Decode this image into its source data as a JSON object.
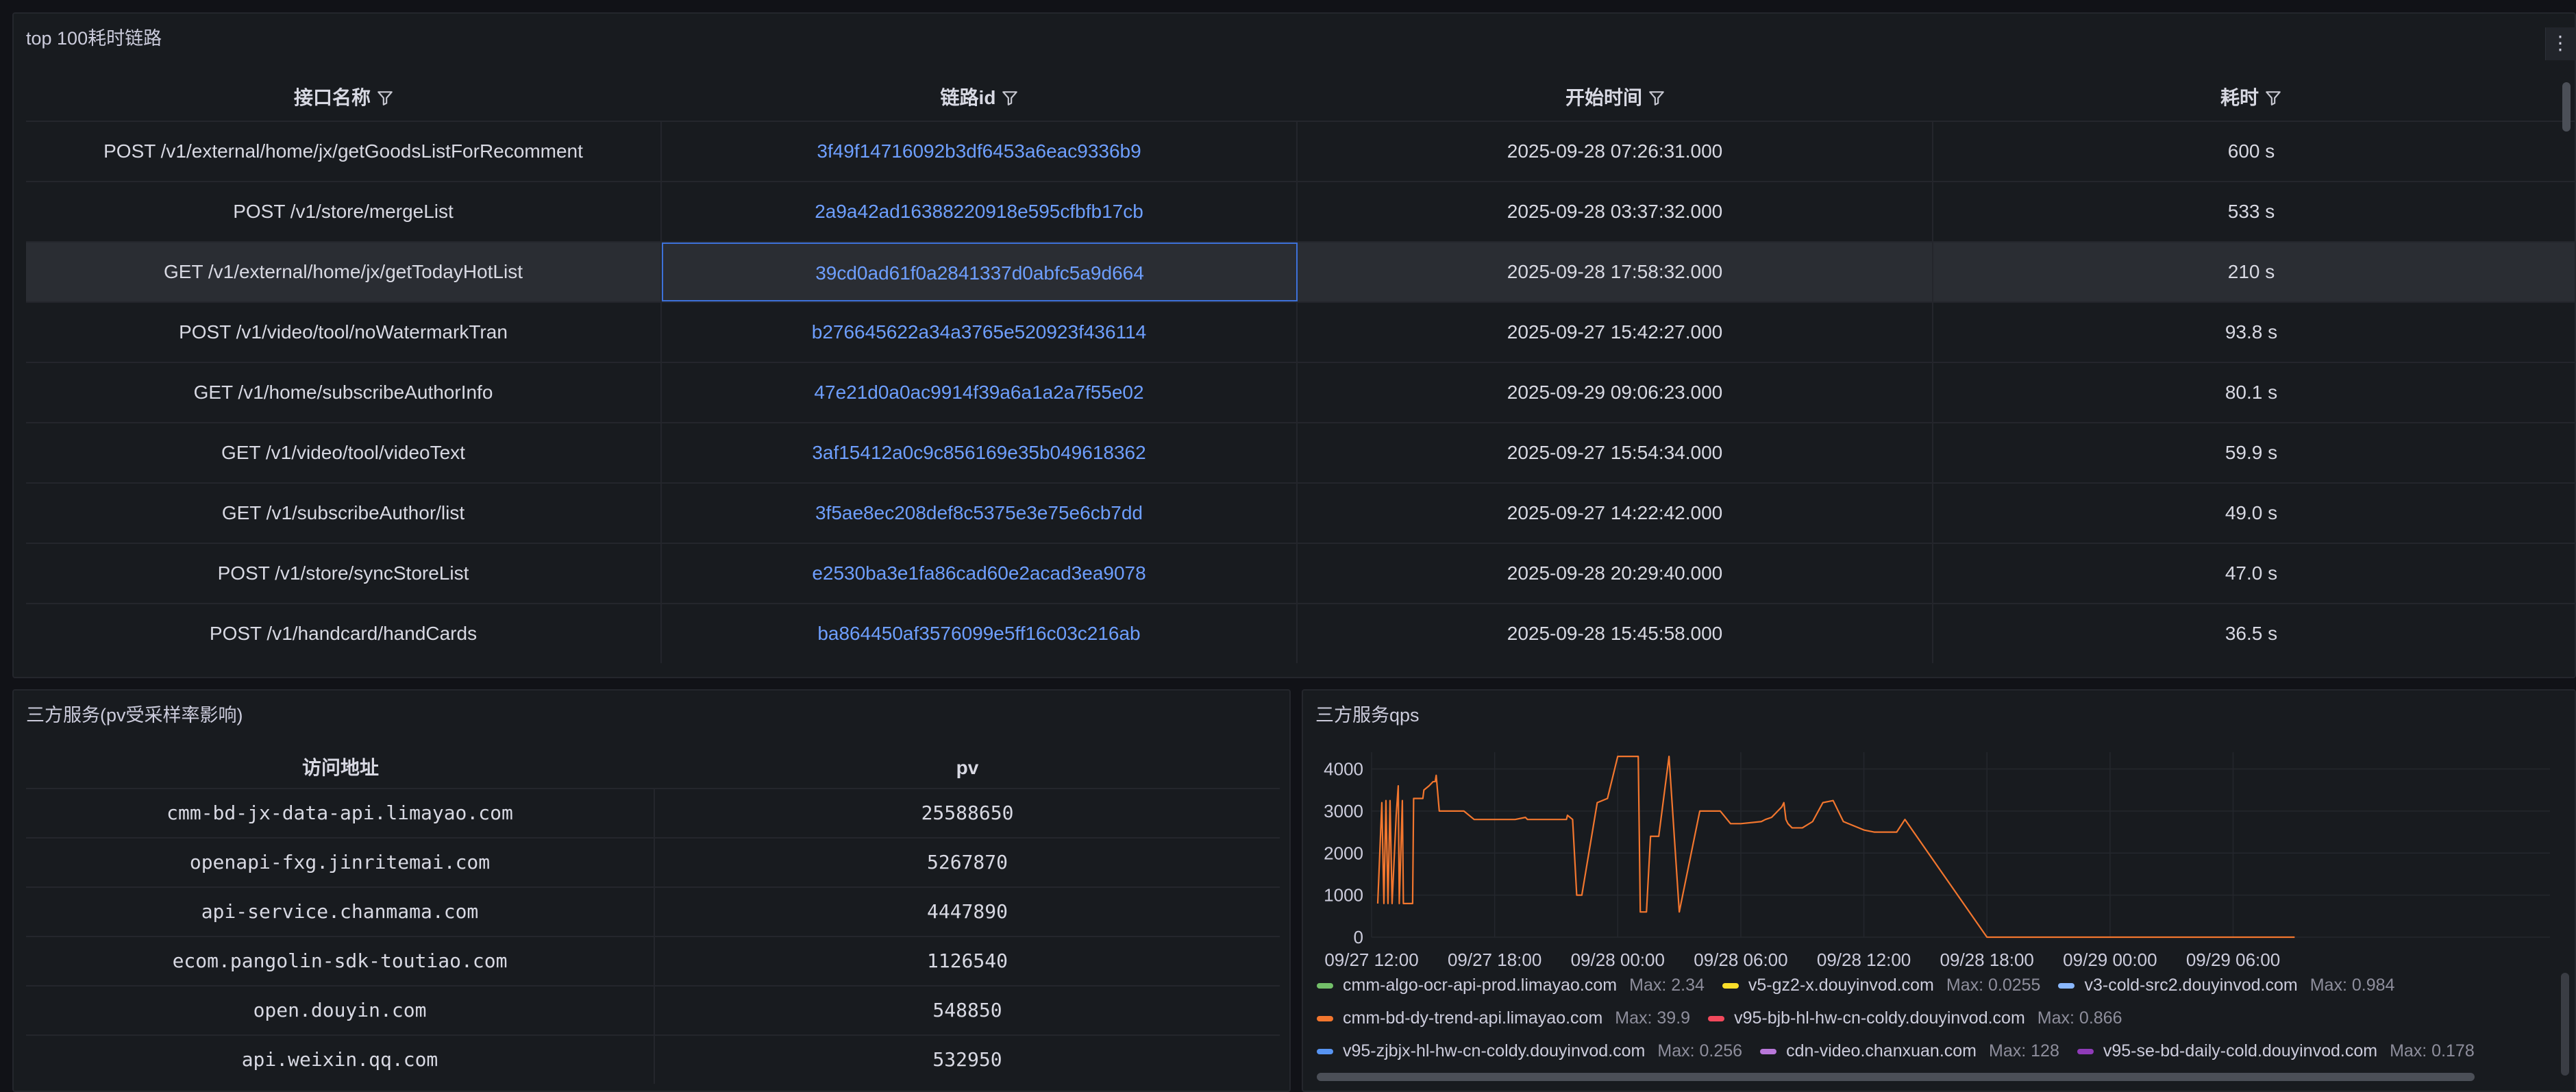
{
  "top_panel": {
    "title": "top 100耗时链路",
    "menu_icon": "⋮",
    "columns": [
      "接口名称",
      "链路id",
      "开始时间",
      "耗时"
    ],
    "rows": [
      [
        "POST /v1/external/home/jx/getGoodsListForRecomment",
        "3f49f14716092b3df6453a6eac9336b9",
        "2025-09-28 07:26:31.000",
        "600 s"
      ],
      [
        "POST /v1/store/mergeList",
        "2a9a42ad16388220918e595cfbfb17cb",
        "2025-09-28 03:37:32.000",
        "533 s"
      ],
      [
        "GET /v1/external/home/jx/getTodayHotList",
        "39cd0ad61f0a2841337d0abfc5a9d664",
        "2025-09-28 17:58:32.000",
        "210 s"
      ],
      [
        "POST /v1/video/tool/noWatermarkTran",
        "b276645622a34a3765e520923f436114",
        "2025-09-27 15:42:27.000",
        "93.8 s"
      ],
      [
        "GET /v1/home/subscribeAuthorInfo",
        "47e21d0a0ac9914f39a6a1a2a7f55e02",
        "2025-09-29 09:06:23.000",
        "80.1 s"
      ],
      [
        "GET /v1/video/tool/videoText",
        "3af15412a0c9c856169e35b049618362",
        "2025-09-27 15:54:34.000",
        "59.9 s"
      ],
      [
        "GET /v1/subscribeAuthor/list",
        "3f5ae8ec208def8c5375e3e75e6cb7dd",
        "2025-09-27 14:22:42.000",
        "49.0 s"
      ],
      [
        "POST /v1/store/syncStoreList",
        "e2530ba3e1fa86cad60e2acad3ea9078",
        "2025-09-28 20:29:40.000",
        "47.0 s"
      ],
      [
        "POST /v1/handcard/handCards",
        "ba864450af3576099e5ff16c03c216ab",
        "2025-09-28 15:45:58.000",
        "36.5 s"
      ]
    ],
    "highlighted_row": 2
  },
  "pv_panel": {
    "title": "三方服务(pv受采样率影响)",
    "columns": [
      "访问地址",
      "pv"
    ],
    "rows": [
      [
        "cmm-bd-jx-data-api.limayao.com",
        "25588650"
      ],
      [
        "openapi-fxg.jinritemai.com",
        "5267870"
      ],
      [
        "api-service.chanmama.com",
        "4447890"
      ],
      [
        "ecom.pangolin-sdk-toutiao.com",
        "1126540"
      ],
      [
        "open.douyin.com",
        "548850"
      ],
      [
        "api.weixin.qq.com",
        "532950"
      ]
    ]
  },
  "qps_panel": {
    "title": "三方服务qps"
  },
  "chart_data": {
    "type": "line",
    "title": "三方服务qps",
    "ylim": [
      0,
      4400
    ],
    "y_ticks": [
      "4000",
      "3000",
      "2000",
      "1000",
      "0"
    ],
    "x_ticks": [
      "09/27 12:00",
      "09/27 18:00",
      "09/28 00:00",
      "09/28 06:00",
      "09/28 12:00",
      "09/28 18:00",
      "09/29 00:00",
      "09/29 06:00"
    ],
    "grid": true,
    "legend_position": "bottom",
    "series": [
      {
        "name": "cmm-bd-dy-trend-api.limayao.com",
        "color": "#f2762e",
        "x": [
          10.3,
          10.5,
          10.6,
          10.7,
          10.8,
          10.9,
          11.0,
          11.2,
          11.3,
          11.35,
          11.5,
          11.55,
          11.7,
          11.9,
          12.0,
          12.05,
          12.5,
          12.55,
          12.8,
          13.0,
          13.1,
          13.15,
          13.3,
          14.5,
          15.0,
          16.0,
          17.0,
          17.5,
          17.6,
          18.0,
          18.5,
          19.0,
          19.5,
          19.55,
          19.8,
          20.0,
          20.2,
          20.25,
          21.0,
          21.5,
          22.0,
          22.3,
          22.35,
          22.8,
          23.0,
          23.1,
          23.3,
          23.4,
          23.6,
          24.0,
          24.5,
          25.0,
          26.0,
          26.5,
          27.0,
          27.5,
          28.0,
          29.0,
          29.2,
          29.5,
          29.6,
          29.7,
          29.8,
          30.0,
          30.1,
          30.2,
          30.3,
          30.5,
          31.0,
          31.5,
          32.0,
          32.5,
          33.0,
          33.5,
          34.0,
          34.5,
          35.5,
          35.6,
          36.0,
          40.0,
          45.0,
          50.0,
          55.0
        ],
        "y": [
          800,
          3200,
          800,
          3250,
          800,
          3250,
          800,
          2900,
          3600,
          800,
          3250,
          800,
          800,
          800,
          800,
          3300,
          3300,
          3500,
          3600,
          3700,
          3700,
          3850,
          3000,
          3000,
          2800,
          2800,
          2800,
          2850,
          2800,
          2800,
          2800,
          2800,
          2800,
          2900,
          2800,
          1000,
          1000,
          1000,
          3200,
          3300,
          4300,
          4300,
          4300,
          4300,
          4300,
          600,
          600,
          600,
          2400,
          2400,
          4300,
          600,
          3000,
          3000,
          3000,
          2700,
          2700,
          2750,
          2800,
          2850,
          2900,
          2950,
          3000,
          3100,
          3200,
          2800,
          2700,
          2600,
          2600,
          2750,
          3200,
          3250,
          2750,
          2650,
          2550,
          2500,
          2500,
          2500,
          2800,
          0,
          0,
          0,
          0
        ]
      },
      {
        "name": "cmm-algo-ocr-api-prod.limayao.com",
        "color": "#73bf69",
        "max": "2.34"
      },
      {
        "name": "v5-gz2-x.douyinvod.com",
        "color": "#fade2a",
        "max": "0.0255"
      },
      {
        "name": "v3-cold-src2.douyinvod.com",
        "color": "#8ab8ff",
        "max": "0.984"
      },
      {
        "name": "v95-bjb-hl-hw-cn-coldy.douyinvod.com",
        "color": "#f2495c",
        "max": "0.866"
      },
      {
        "name": "v95-zjbjx-hl-hw-cn-coldy.douyinvod.com",
        "color": "#5794f2",
        "max": "0.256"
      },
      {
        "name": "cdn-video.chanxuan.com",
        "color": "#b877d9",
        "max": "128"
      },
      {
        "name": "v95-se-bd-daily-cold.douyinvod.com",
        "color": "#8f3bb8",
        "max": "0.178"
      }
    ],
    "legend_rows": [
      [
        {
          "name": "cmm-algo-ocr-api-prod.limayao.com",
          "max_label": "Max: 2.34",
          "color": "#73bf69"
        },
        {
          "name": "v5-gz2-x.douyinvod.com",
          "max_label": "Max: 0.0255",
          "color": "#fade2a"
        },
        {
          "name": "v3-cold-src2.douyinvod.com",
          "max_label": "Max: 0.984",
          "color": "#8ab8ff"
        }
      ],
      [
        {
          "name": "cmm-bd-dy-trend-api.limayao.com",
          "max_label": "Max: 39.9",
          "color": "#f2762e"
        },
        {
          "name": "v95-bjb-hl-hw-cn-coldy.douyinvod.com",
          "max_label": "Max: 0.866",
          "color": "#f2495c"
        }
      ],
      [
        {
          "name": "v95-zjbjx-hl-hw-cn-coldy.douyinvod.com",
          "max_label": "Max: 0.256",
          "color": "#5794f2"
        },
        {
          "name": "cdn-video.chanxuan.com",
          "max_label": "Max: 128",
          "color": "#b877d9"
        },
        {
          "name": "v95-se-bd-daily-cold.douyinvod.com",
          "max_label": "Max: 0.178",
          "color": "#8f3bb8"
        }
      ]
    ]
  }
}
